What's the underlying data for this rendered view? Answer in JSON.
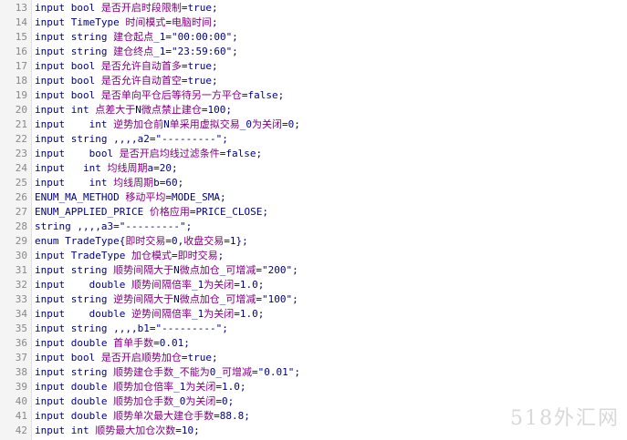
{
  "lines": [
    {
      "n": "13",
      "t": "input bool 是否开启时段限制=true;"
    },
    {
      "n": "14",
      "t": "input TimeType 时间模式=电脑时间;"
    },
    {
      "n": "15",
      "t": "input string 建仓起点_1=\"00:00:00\";"
    },
    {
      "n": "16",
      "t": "input string 建仓终点_1=\"23:59:60\";"
    },
    {
      "n": "17",
      "t": "input bool 是否允许自动首多=true;"
    },
    {
      "n": "18",
      "t": "input bool 是否允许自动首空=true;"
    },
    {
      "n": "19",
      "t": "input bool 是否单向平仓后等待另一方平仓=false;"
    },
    {
      "n": "20",
      "t": "input int 点差大于N微点禁止建仓=100;"
    },
    {
      "n": "21",
      "t": "input    int 逆势加仓前N单采用虚拟交易_0为关闭=0;"
    },
    {
      "n": "22",
      "t": "input string ,,,,a2=\"---------\";"
    },
    {
      "n": "23",
      "t": "input    bool 是否开启均线过滤条件=false;"
    },
    {
      "n": "24",
      "t": "input   int 均线周期a=20;"
    },
    {
      "n": "25",
      "t": "input    int 均线周期b=60;"
    },
    {
      "n": "26",
      "t": "ENUM_MA_METHOD 移动平均=MODE_SMA;"
    },
    {
      "n": "27",
      "t": "ENUM_APPLIED_PRICE 价格应用=PRICE_CLOSE;"
    },
    {
      "n": "28",
      "t": "string ,,,,a3=\"---------\";"
    },
    {
      "n": "29",
      "t": "enum TradeType{即时交易=0,收盘交易=1};"
    },
    {
      "n": "30",
      "t": "input TradeType 加仓模式=即时交易;"
    },
    {
      "n": "31",
      "t": "input string 顺势间隔大于N微点加仓_可增减=\"200\";"
    },
    {
      "n": "32",
      "t": "input    double 顺势间隔倍率_1为关闭=1.0;"
    },
    {
      "n": "33",
      "t": "input string 逆势间隔大于N微点加仓_可增减=\"100\";"
    },
    {
      "n": "34",
      "t": "input    double 逆势间隔倍率_1为关闭=1.0;"
    },
    {
      "n": "35",
      "t": "input string ,,,,b1=\"---------\";"
    },
    {
      "n": "36",
      "t": "input double 首单手数=0.01;"
    },
    {
      "n": "37",
      "t": "input bool 是否开启顺势加仓=true;"
    },
    {
      "n": "38",
      "t": "input string 顺势建仓手数_不能为0_可增减=\"0.01\";"
    },
    {
      "n": "39",
      "t": "input double 顺势加仓倍率_1为关闭=1.0;"
    },
    {
      "n": "40",
      "t": "input double 顺势加仓手数_0为关闭=0;"
    },
    {
      "n": "41",
      "t": "input double 顺势单次最大建仓手数=88.8;"
    },
    {
      "n": "42",
      "t": "input int 顺势最大加仓次数=10;"
    }
  ],
  "watermark": "518外汇网",
  "colors": {
    "keyword": "#000080",
    "chinese": "#800080",
    "linenumber": "#888888"
  }
}
